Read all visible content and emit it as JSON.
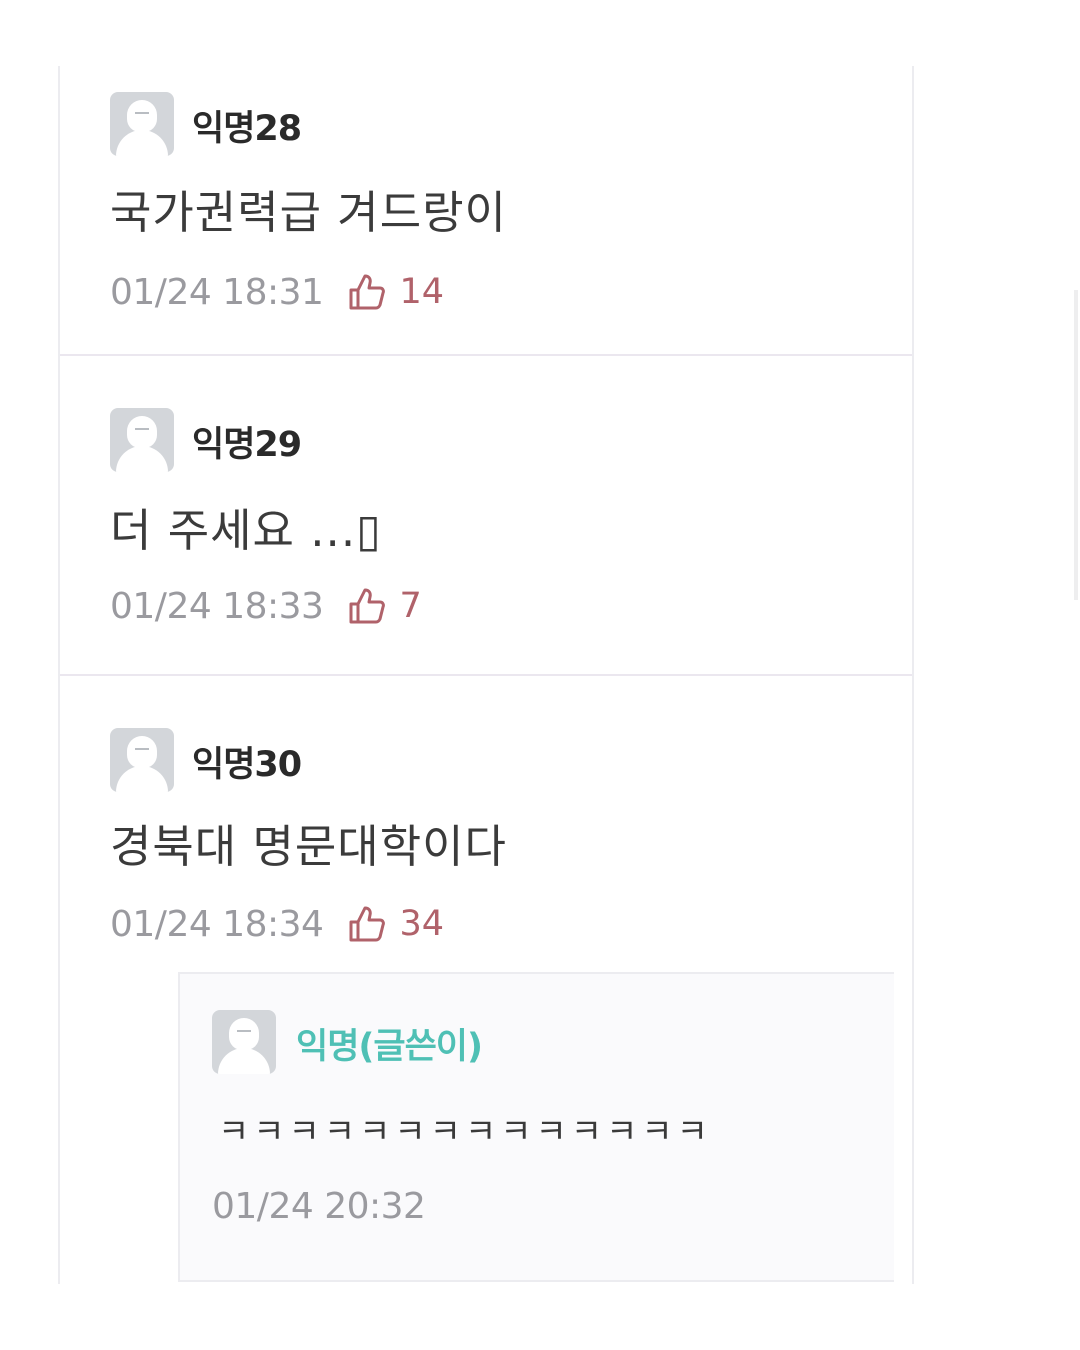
{
  "comments": [
    {
      "author": "익명28",
      "text": "국가권력급 겨드랑이",
      "time": "01/24 18:31",
      "likes": "14"
    },
    {
      "author": "익명29",
      "text": "더 주세요 ...▯",
      "time": "01/24 18:33",
      "likes": "7"
    },
    {
      "author": "익명30",
      "text": "경북대 명문대학이다",
      "time": "01/24 18:34",
      "likes": "34",
      "reply": {
        "author": "익명(글쓴이)",
        "text": "ㅋㅋㅋㅋㅋㅋㅋㅋㅋㅋㅋㅋㅋㅋ",
        "time": "01/24 20:32"
      }
    }
  ],
  "icons": {
    "avatar": "default-avatar-icon",
    "like": "thumbs-up-icon"
  },
  "colors": {
    "op_author": "#4fc0b5",
    "like_icon": "#b0626a",
    "timestamp": "#9a9a9f",
    "author": "#2a2a2a"
  }
}
